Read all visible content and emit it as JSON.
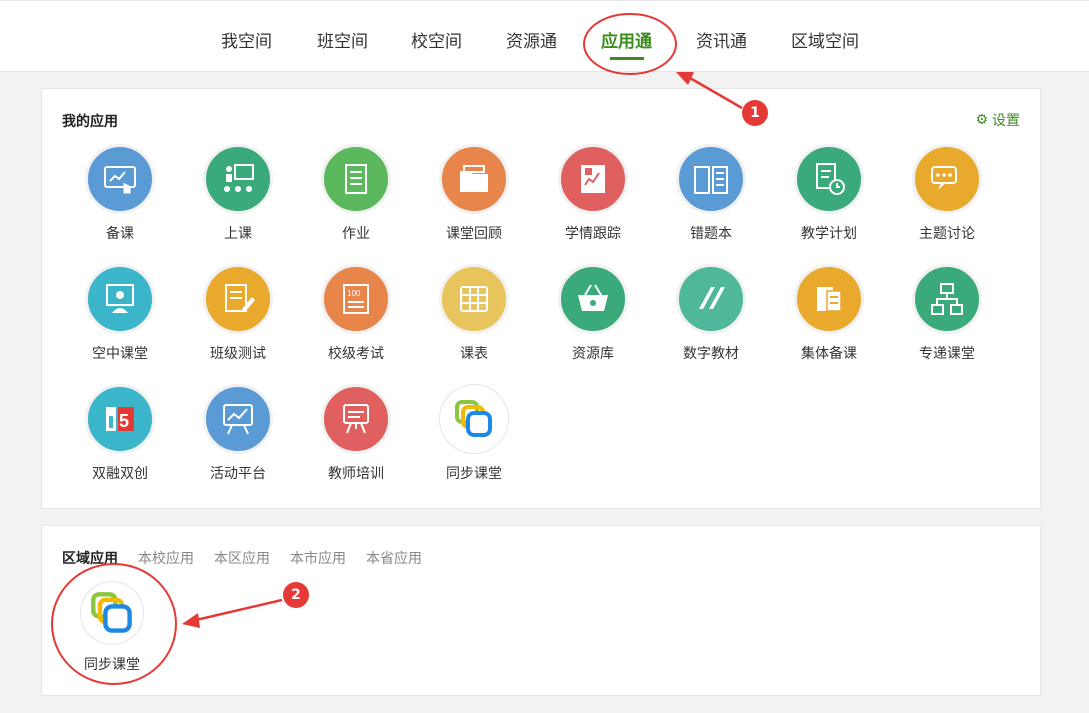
{
  "nav": {
    "tabs": [
      "我空间",
      "班空间",
      "校空间",
      "资源通",
      "应用通",
      "资讯通",
      "区域空间"
    ],
    "active_index": 4
  },
  "my_apps": {
    "title": "我的应用",
    "settings_label": "设置",
    "apps": [
      {
        "label": "备课",
        "color": "#5b9bd5",
        "icon": "presentation-touch-icon"
      },
      {
        "label": "上课",
        "color": "#3aaa7a",
        "icon": "teacher-board-icon"
      },
      {
        "label": "作业",
        "color": "#5cb85c",
        "icon": "scroll-icon"
      },
      {
        "label": "课堂回顾",
        "color": "#e8854a",
        "icon": "folder-icon"
      },
      {
        "label": "学情跟踪",
        "color": "#e06060",
        "icon": "chart-report-icon"
      },
      {
        "label": "错题本",
        "color": "#5b9bd5",
        "icon": "open-book-icon"
      },
      {
        "label": "教学计划",
        "color": "#3aaa7a",
        "icon": "document-clock-icon"
      },
      {
        "label": "主题讨论",
        "color": "#e8a92c",
        "icon": "chat-bubbles-icon"
      },
      {
        "label": "空中课堂",
        "color": "#3ab5c9",
        "icon": "online-class-icon"
      },
      {
        "label": "班级测试",
        "color": "#e8a92c",
        "icon": "test-paper-icon"
      },
      {
        "label": "校级考试",
        "color": "#e8854a",
        "icon": "exam-score-icon"
      },
      {
        "label": "课表",
        "color": "#e8c45c",
        "icon": "timetable-icon"
      },
      {
        "label": "资源库",
        "color": "#3aaa7a",
        "icon": "basket-icon"
      },
      {
        "label": "数字教材",
        "color": "#4fb89a",
        "icon": "digital-book-icon"
      },
      {
        "label": "集体备课",
        "color": "#e8a92c",
        "icon": "group-prep-icon"
      },
      {
        "label": "专递课堂",
        "color": "#3aaa7a",
        "icon": "network-icon"
      },
      {
        "label": "双融双创",
        "color": "#3ab5c9",
        "icon": "i5-logo-icon"
      },
      {
        "label": "活动平台",
        "color": "#5b9bd5",
        "icon": "easel-chart-icon"
      },
      {
        "label": "教师培训",
        "color": "#e06060",
        "icon": "training-board-icon"
      },
      {
        "label": "同步课堂",
        "color": "#ffffff",
        "icon": "sync-class-icon"
      }
    ]
  },
  "region_apps": {
    "tabs": [
      "区域应用",
      "本校应用",
      "本区应用",
      "本市应用",
      "本省应用"
    ],
    "active_index": 0,
    "apps": [
      {
        "label": "同步课堂",
        "icon": "sync-class-icon"
      }
    ]
  },
  "annotations": [
    {
      "number": "1"
    },
    {
      "number": "2"
    }
  ]
}
